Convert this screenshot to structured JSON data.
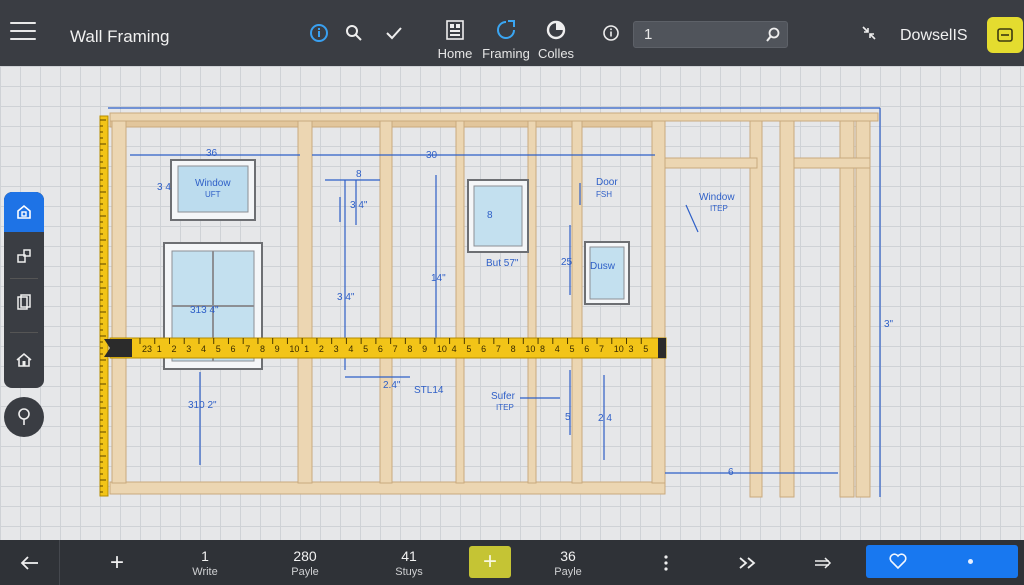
{
  "app": {
    "title": "Wall Framing",
    "user": "DowselIS"
  },
  "toolbar": {
    "groups": [
      {
        "label": "Home"
      },
      {
        "label": "Framing"
      },
      {
        "label": "Colles"
      }
    ],
    "search_value": "1"
  },
  "colors": {
    "accent": "#1e73e6",
    "bar": "#3a3d43",
    "lumber": "#e9d3b0",
    "dimension": "#2e5fc7",
    "tape": "#f2c418",
    "action_yellow": "#e4dc2f"
  },
  "wall": {
    "dimensions": [
      {
        "text": "36"
      },
      {
        "text": "30"
      },
      {
        "text": "3\""
      },
      {
        "text": "8"
      },
      {
        "text": "6"
      },
      {
        "text": "3 4"
      },
      {
        "text": "3 4\""
      },
      {
        "text": "3 4\""
      },
      {
        "text": "14\""
      },
      {
        "text": "313 4\""
      },
      {
        "text": "310 2\""
      },
      {
        "text": "2.4\""
      },
      {
        "text": "STL14"
      },
      {
        "text": "25"
      },
      {
        "text": "2 4"
      },
      {
        "text": "5"
      },
      {
        "text": "8"
      }
    ],
    "labels": [
      {
        "line1": "Window",
        "line2": "UFT"
      },
      {
        "line1": "Door",
        "line2": "FSH"
      },
      {
        "line1": "Window",
        "line2": "ITEP"
      },
      {
        "line1": "Sufer",
        "line2": "ITEP"
      },
      {
        "line1": "But 57\"",
        "line2": ""
      },
      {
        "line1": "Dusw",
        "line2": ""
      }
    ]
  },
  "tape": {
    "ticks": [
      "23",
      "1",
      "2",
      "3",
      "4",
      "5",
      "6",
      "7",
      "8",
      "9",
      "10",
      "1",
      "2",
      "3",
      "4",
      "5",
      "6",
      "7",
      "8",
      "9",
      "10",
      "4",
      "5",
      "6",
      "7",
      "8",
      "10",
      "8",
      "4",
      "5",
      "6",
      "7",
      "10",
      "3",
      "5"
    ]
  },
  "bottombar": {
    "stats": [
      {
        "value": "1",
        "label": "Write"
      },
      {
        "value": "280",
        "label": "Payle"
      },
      {
        "value": "41",
        "label": "Stuys"
      },
      {
        "value": "36",
        "label": "Payle"
      }
    ]
  }
}
